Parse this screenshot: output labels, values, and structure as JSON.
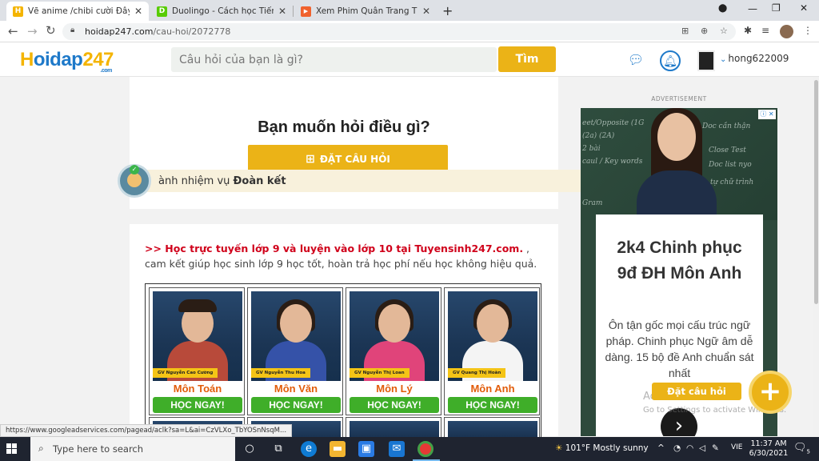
{
  "browser": {
    "tabs": [
      {
        "title": "Vẽ anime /chibi cười Đây là tôi kh",
        "favicon": "H",
        "favicon_color": "#f4b400",
        "active": true
      },
      {
        "title": "Duolingo - Cách học Tiếng Anh t",
        "favicon": "D",
        "favicon_color": "#58cc02",
        "active": false
      },
      {
        "title": "Xem Phim Quân Trang Thân Yêu",
        "favicon": "▶",
        "favicon_color": "#f0612d",
        "active": false
      }
    ],
    "url_host": "hoidap247.com",
    "url_path": "/cau-hoi/2072778"
  },
  "site": {
    "logo": {
      "part1": "H",
      "part2": "oidap",
      "part3": "247",
      "suffix": ".com"
    },
    "search_placeholder": "Câu hỏi của bạn là gì?",
    "search_button": "Tìm",
    "username": "hong622009"
  },
  "ask": {
    "title": "Bạn muốn hỏi điều gì?",
    "button": "ĐẶT CÂU HỎI"
  },
  "mission": {
    "prefix": "ành nhiệm vụ ",
    "name": "Đoàn kết"
  },
  "promo": {
    "link_text": ">> Học trực tuyến lớp 9 và luyện vào lớp 10 tại Tuyensinh247.com.",
    "rest": " , cam kết giúp học sinh lớp 9 học tốt, hoàn trả học phí nếu học không hiệu quả."
  },
  "teachers": [
    {
      "name": "GV Nguyễn Cao Cường",
      "subject": "Môn Toán",
      "button": "HỌC NGAY!"
    },
    {
      "name": "GV Nguyễn Thu Hoa",
      "subject": "Môn Văn",
      "button": "HỌC NGAY!"
    },
    {
      "name": "GV Nguyễn Thị Loan",
      "subject": "Môn Lý",
      "button": "HỌC NGAY!"
    },
    {
      "name": "GV Quang Thị Hoàn",
      "subject": "Môn Anh",
      "button": "HỌC NGAY!"
    }
  ],
  "ad": {
    "label": "ADVERTISEMENT",
    "headline_line1": "2k4 Chinh phục",
    "headline_line2": "9đ ĐH Môn Anh",
    "body": "Ôn tận gốc mọi cấu trúc ngữ pháp. Chinh phục Ngữ âm dễ dàng. 15 bộ đề Anh chuẩn sát nhất",
    "chalk": [
      "eet/Opposite (1G",
      "Doc cần thận",
      "(2a) (2A)",
      "2 bài",
      "Close Test",
      "caul / Key words",
      "Doc list nyo",
      "Gram",
      "tự chữ trình"
    ]
  },
  "fab": {
    "label": "Đặt câu hỏi",
    "icon": "+"
  },
  "windows_activation": {
    "line1": "Activate Windows",
    "line2": "Go to Settings to activate Windows."
  },
  "status_url": "https://www.googleadservices.com/pagead/aclk?sa=L&ai=CzVLXo_TbYOSnNsqM...",
  "taskbar": {
    "search_placeholder": "Type here to search",
    "weather": "101°F  Mostly sunny",
    "lang": "VIE",
    "time": "11:37 AM",
    "date": "6/30/2021",
    "notifications": "5"
  }
}
